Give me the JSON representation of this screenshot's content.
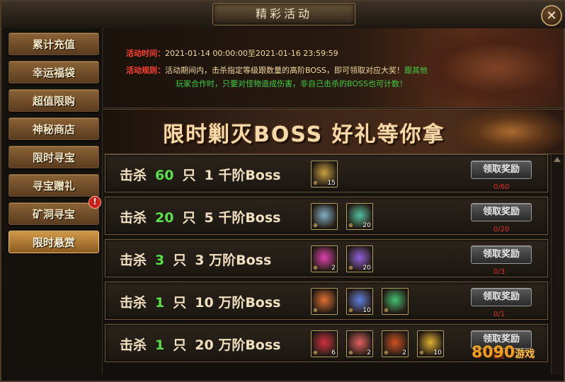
{
  "window": {
    "title": "精彩活动",
    "close_symbol": "✕"
  },
  "sidebar": {
    "items": [
      {
        "label": "累计充值"
      },
      {
        "label": "幸运福袋"
      },
      {
        "label": "超值限购"
      },
      {
        "label": "神秘商店"
      },
      {
        "label": "限时寻宝"
      },
      {
        "label": "寻宝赠礼"
      },
      {
        "label": "矿洞寻宝"
      },
      {
        "label": "限时悬赏"
      }
    ],
    "active_index": 7,
    "alert_badge": "!"
  },
  "info": {
    "time_label": "活动时间：",
    "time_value": "2021-01-14 00:00:00至2021-01-16 23:59:59",
    "rule_label": "活动规则：",
    "rule_text_1": "活动期间内，击杀指定等级跟数量的高阶BOSS，即可领取对应大奖！",
    "rule_text_green_1": "跟其他",
    "rule_text_green_2": "玩家合作时，只要对怪物造成伤害，非自己击杀的BOSS也可计数！"
  },
  "banner": {
    "text": "限时剿灭BOSS  好礼等你拿"
  },
  "tasks": [
    {
      "kill_word": "击杀",
      "count": "60",
      "unit": "只",
      "level": "1 千阶Boss",
      "button": "领取奖励",
      "progress": "0/60",
      "items": [
        {
          "icon": "golden-chest-icon",
          "count": "15",
          "color": "#c8a040"
        }
      ]
    },
    {
      "kill_word": "击杀",
      "count": "20",
      "unit": "只",
      "level": "5 千阶Boss",
      "button": "领取奖励",
      "progress": "0/20",
      "items": [
        {
          "icon": "silver-amulet-icon",
          "count": "",
          "color": "#80b0c8"
        },
        {
          "icon": "green-crystal-icon",
          "count": "20",
          "color": "#50c0a0"
        }
      ]
    },
    {
      "kill_word": "击杀",
      "count": "3",
      "unit": "只",
      "level": "3 万阶Boss",
      "button": "领取奖励",
      "progress": "0/3",
      "items": [
        {
          "icon": "pink-gem-icon",
          "count": "2",
          "color": "#e040b0"
        },
        {
          "icon": "purple-crystal-icon",
          "count": "20",
          "color": "#9060e0"
        }
      ]
    },
    {
      "kill_word": "击杀",
      "count": "1",
      "unit": "只",
      "level": "10 万阶Boss",
      "button": "领取奖励",
      "progress": "0/1",
      "items": [
        {
          "icon": "rainbow-orb-icon",
          "count": "",
          "color": "#e07030"
        },
        {
          "icon": "blue-feather-icon",
          "count": "10",
          "color": "#6080e0"
        },
        {
          "icon": "green-shard-icon",
          "count": "",
          "color": "#40c070"
        }
      ]
    },
    {
      "kill_word": "击杀",
      "count": "1",
      "unit": "只",
      "level": "20 万阶Boss",
      "button": "领取奖励",
      "progress": "0/1",
      "items": [
        {
          "icon": "red-pendant-icon",
          "count": "6",
          "color": "#d03040"
        },
        {
          "icon": "red-crystal-icon",
          "count": "2",
          "color": "#e06060"
        },
        {
          "icon": "fire-orb-icon",
          "count": "2",
          "color": "#d05020"
        },
        {
          "icon": "gold-coin-icon",
          "count": "10",
          "color": "#e0b030"
        }
      ]
    }
  ],
  "watermark": {
    "number": "8090",
    "text": "游戏"
  }
}
